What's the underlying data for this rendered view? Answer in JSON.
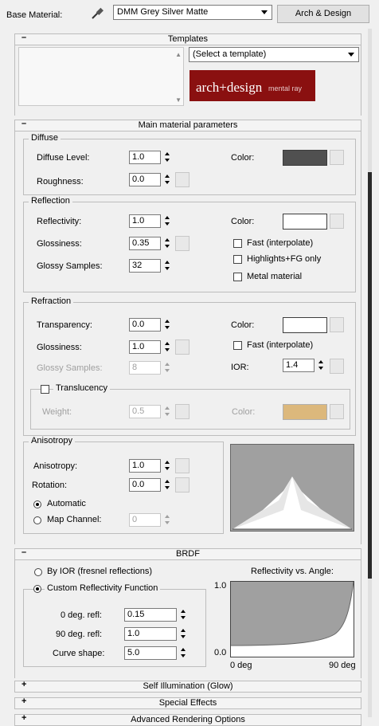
{
  "base_material": {
    "label": "Base Material:",
    "value": "DMM Grey Silver Matte",
    "type_button": "Arch & Design"
  },
  "templates": {
    "title": "Templates",
    "sign": "–",
    "select": "(Select a template)",
    "logo_main": "arch+design",
    "logo_sub": "mental ray"
  },
  "main": {
    "title": "Main material parameters",
    "sign": "–",
    "diffuse": {
      "title": "Diffuse",
      "level_label": "Diffuse Level:",
      "level": "1.0",
      "rough_label": "Roughness:",
      "rough": "0.0",
      "color_label": "Color:",
      "color": "#505050"
    },
    "reflection": {
      "title": "Reflection",
      "refl_label": "Reflectivity:",
      "refl": "1.0",
      "gloss_label": "Glossiness:",
      "gloss": "0.35",
      "samples_label": "Glossy Samples:",
      "samples": "32",
      "color_label": "Color:",
      "color": "#ffffff",
      "fast": "Fast (interpolate)",
      "highlights": "Highlights+FG only",
      "metal": "Metal material"
    },
    "refraction": {
      "title": "Refraction",
      "trans_label": "Transparency:",
      "trans": "0.0",
      "gloss_label": "Glossiness:",
      "gloss": "1.0",
      "samples_label": "Glossy Samples:",
      "samples": "8",
      "color_label": "Color:",
      "color": "#ffffff",
      "fast": "Fast (interpolate)",
      "ior_label": "IOR:",
      "ior": "1.4",
      "translucency": "Translucency",
      "weight_label": "Weight:",
      "weight": "0.5",
      "tcolor_label": "Color:",
      "tcolor": "#dcb87c"
    },
    "anisotropy": {
      "title": "Anisotropy",
      "aniso_label": "Anisotropy:",
      "aniso": "1.0",
      "rot_label": "Rotation:",
      "rot": "0.0",
      "automatic": "Automatic",
      "map_channel": "Map Channel:",
      "channel": "0"
    }
  },
  "brdf": {
    "title": "BRDF",
    "sign": "–",
    "by_ior": "By IOR (fresnel reflections)",
    "custom": "Custom Reflectivity Function",
    "deg0_label": "0 deg. refl:",
    "deg0": "0.15",
    "deg90_label": "90 deg. refl:",
    "deg90": "1.0",
    "curve_label": "Curve shape:",
    "curve": "5.0",
    "graph_title": "Reflectivity vs. Angle:",
    "y_max": "1.0",
    "y_min": "0.0",
    "x_min": "0 deg",
    "x_max": "90 deg"
  },
  "collapsed": [
    {
      "title": "Self Illumination (Glow)",
      "sign": "+"
    },
    {
      "title": "Special Effects",
      "sign": "+"
    },
    {
      "title": "Advanced Rendering Options",
      "sign": "+"
    }
  ]
}
